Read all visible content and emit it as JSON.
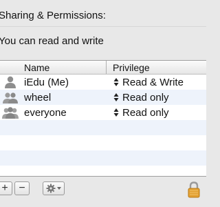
{
  "panel": {
    "section_title": "Sharing & Permissions:",
    "permission_summary": "You can read and write"
  },
  "table": {
    "headers": {
      "name": "Name",
      "privilege": "Privilege"
    },
    "rows": [
      {
        "name": "iEdu (Me)",
        "privilege": "Read & Write",
        "icon": "single-user-icon"
      },
      {
        "name": "wheel",
        "privilege": "Read only",
        "icon": "group-icon"
      },
      {
        "name": "everyone",
        "privilege": "Read only",
        "icon": "everyone-group-icon"
      }
    ]
  },
  "toolbar": {
    "add_label": "+",
    "remove_label": "−",
    "action_icon": "gear-icon",
    "lock_icon": "lock-icon"
  },
  "colors": {
    "background": "#e8e8e8",
    "row_alt": "#eef3fb",
    "lock": "#e3a032"
  }
}
